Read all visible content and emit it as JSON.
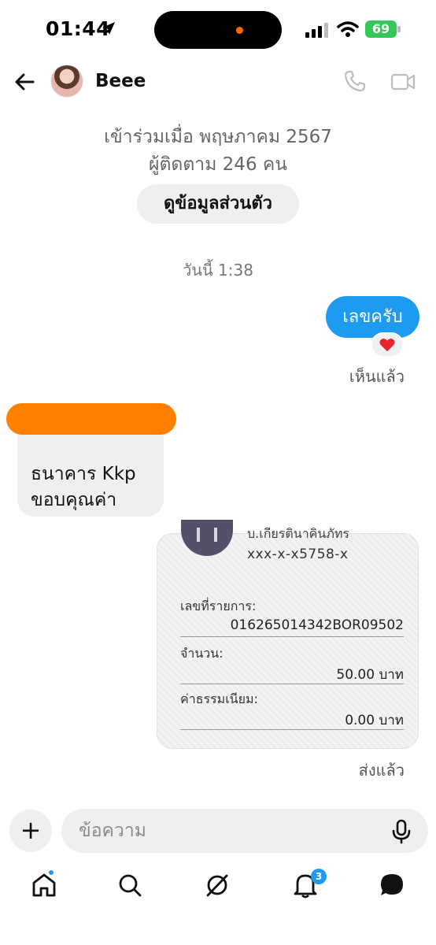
{
  "status_bar": {
    "time": "01:44",
    "battery": "69"
  },
  "header": {
    "contact_name": "Beee"
  },
  "profile": {
    "joined": "เข้าร่วมเมื่อ พฤษภาคม 2567",
    "followers": "ผู้ติดตาม 246 คน",
    "view_profile_label": "ดูข้อมูลส่วนตัว"
  },
  "conversation": {
    "timestamp": "วันนี้ 1:38",
    "outgoing_text": "เลขครับ",
    "reaction": "❤️",
    "seen_label": "เห็นแล้ว",
    "incoming_line1": "ธนาคาร Kkp",
    "incoming_line2": "ขอบคุณค่า",
    "receipt": {
      "cut_header": "บ.เกียรตินาคินภัทร",
      "account": "xxx-x-x5758-x",
      "ref_label": "เลขที่รายการ:",
      "ref_value": "016265014342BOR09502",
      "amount_label": "จำนวน:",
      "amount_value": "50.00 บาท",
      "fee_label": "ค่าธรรมเนียม:",
      "fee_value": "0.00 บาท"
    },
    "sent_label": "ส่งแล้ว"
  },
  "composer": {
    "placeholder": "ข้อความ",
    "plus_label": "+"
  },
  "nav": {
    "notifications_count": "3"
  },
  "colors": {
    "accent": "#1d9bf0",
    "redaction": "#ff7f00",
    "battery": "#35c759"
  }
}
